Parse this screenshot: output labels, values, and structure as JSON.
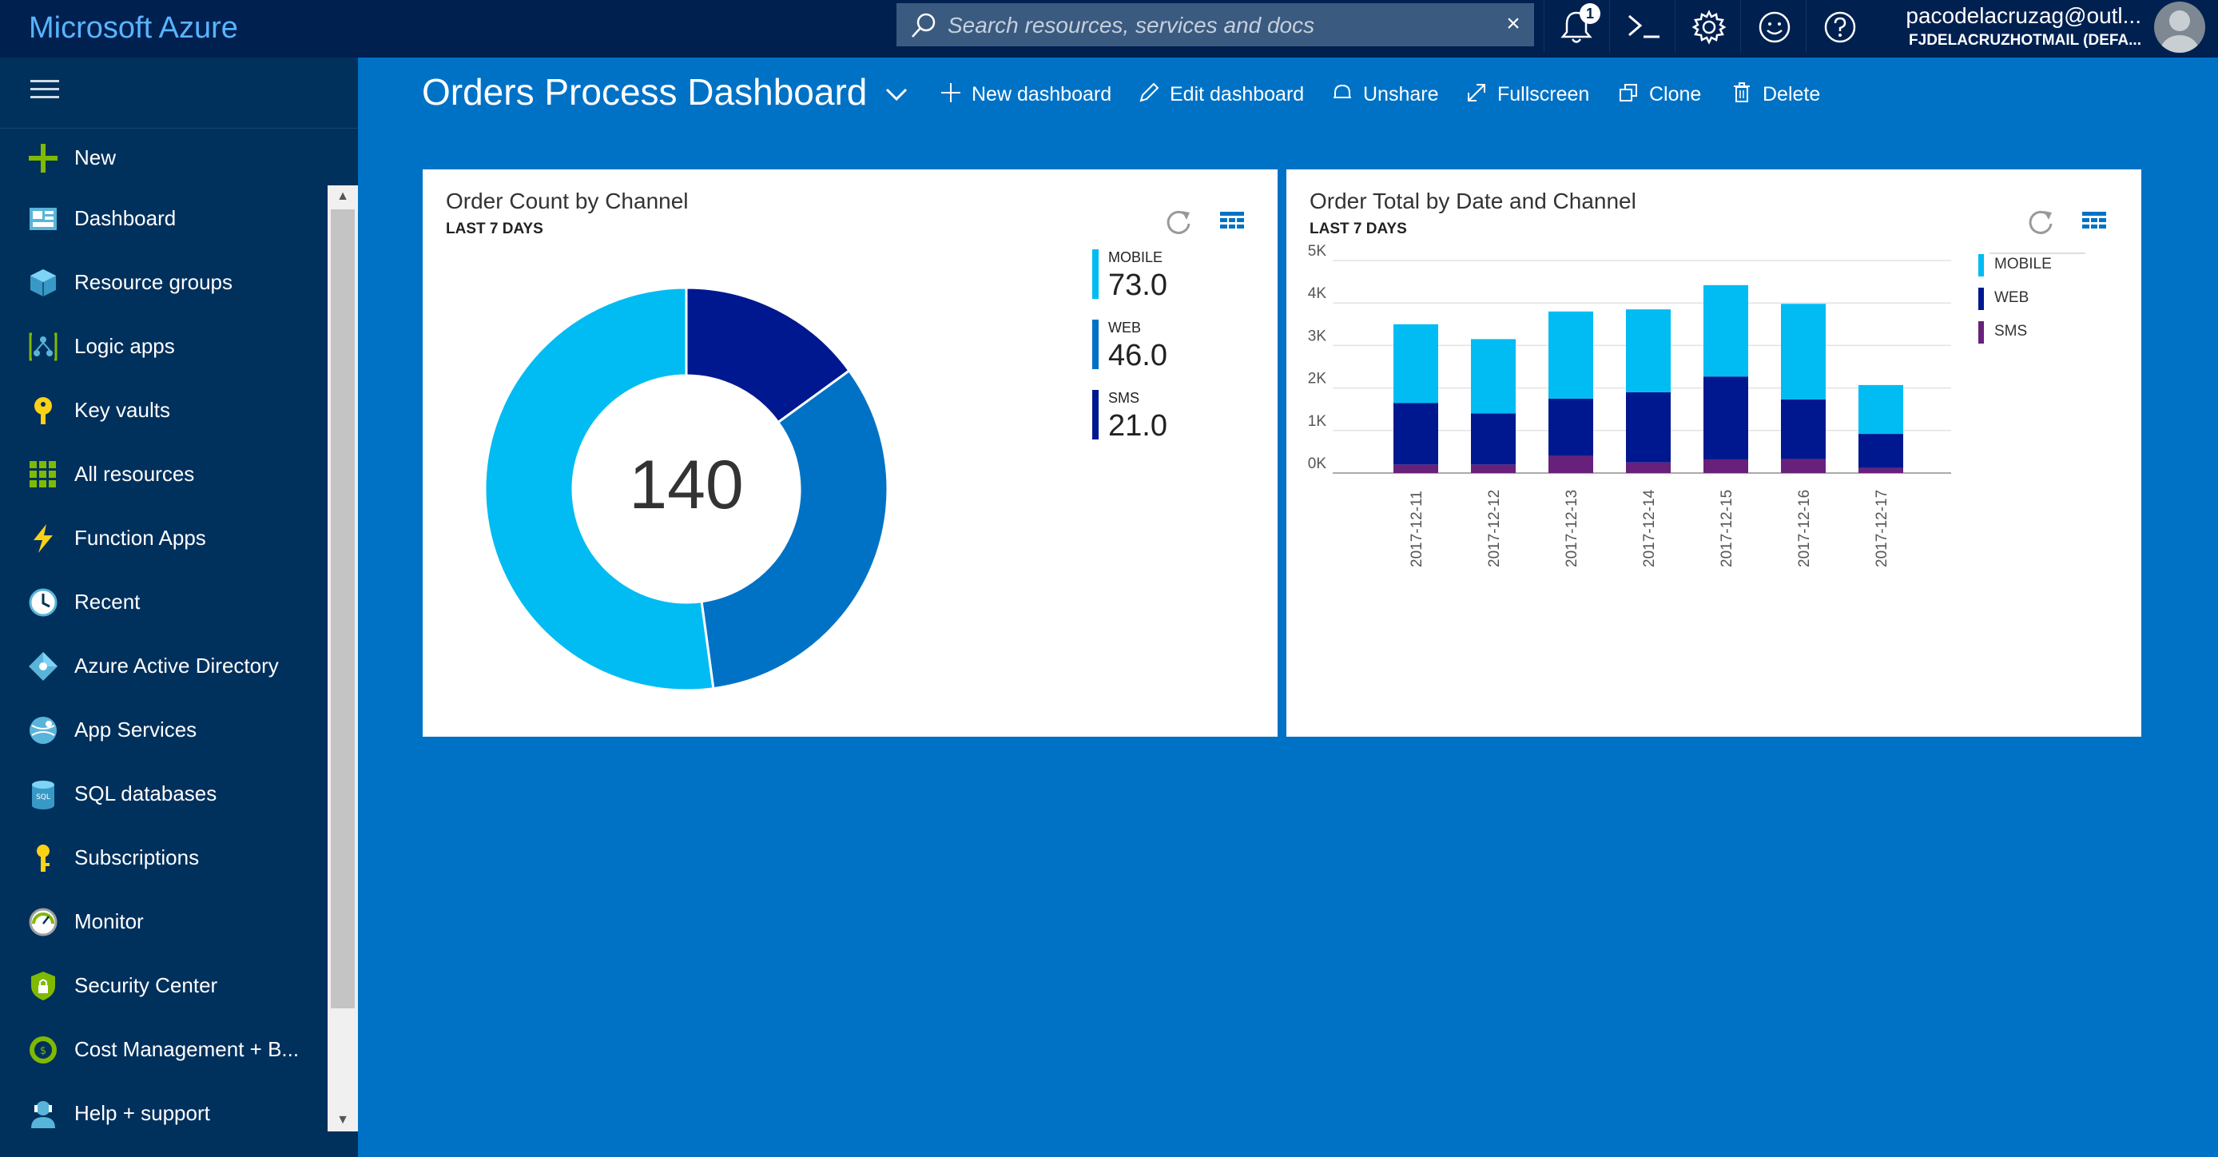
{
  "app": {
    "title": "Microsoft Azure"
  },
  "search": {
    "placeholder": "Search resources, services and docs",
    "clear": "×"
  },
  "topbar": {
    "notifications_count": "1"
  },
  "account": {
    "email": "pacodelacruzag@outl...",
    "tenant": "FJDELACRUZHOTMAIL (DEFA..."
  },
  "sidebar": {
    "items": [
      {
        "label": "New",
        "icon": "plus-icon"
      },
      {
        "label": "Dashboard",
        "icon": "dashboard-icon"
      },
      {
        "label": "Resource groups",
        "icon": "resource-groups-icon"
      },
      {
        "label": "Logic apps",
        "icon": "logic-apps-icon"
      },
      {
        "label": "Key vaults",
        "icon": "key-vault-icon"
      },
      {
        "label": "All resources",
        "icon": "all-resources-icon"
      },
      {
        "label": "Function Apps",
        "icon": "function-apps-icon"
      },
      {
        "label": "Recent",
        "icon": "clock-icon"
      },
      {
        "label": "Azure Active Directory",
        "icon": "active-directory-icon"
      },
      {
        "label": "App Services",
        "icon": "app-services-icon"
      },
      {
        "label": "SQL databases",
        "icon": "sql-database-icon"
      },
      {
        "label": "Subscriptions",
        "icon": "key-icon"
      },
      {
        "label": "Monitor",
        "icon": "monitor-icon"
      },
      {
        "label": "Security Center",
        "icon": "shield-icon"
      },
      {
        "label": "Cost Management + B...",
        "icon": "cost-management-icon"
      },
      {
        "label": "Help + support",
        "icon": "help-support-icon"
      }
    ]
  },
  "dashboard": {
    "title": "Orders Process Dashboard",
    "commands": {
      "new": "New dashboard",
      "edit": "Edit dashboard",
      "unshare": "Unshare",
      "fullscreen": "Fullscreen",
      "clone": "Clone",
      "delete": "Delete"
    }
  },
  "tiles": {
    "donut": {
      "title": "Order Count by Channel",
      "subtitle": "LAST 7 DAYS",
      "total": "140",
      "legend": [
        {
          "name": "MOBILE",
          "value": "73.0"
        },
        {
          "name": "WEB",
          "value": "46.0"
        },
        {
          "name": "SMS",
          "value": "21.0"
        }
      ]
    },
    "bars": {
      "title": "Order Total by Date and Channel",
      "subtitle": "LAST 7 DAYS",
      "legend": [
        "MOBILE",
        "WEB",
        "SMS"
      ]
    }
  },
  "colors": {
    "mobile": "#00bcf2",
    "web_donut": "#0072c6",
    "web": "#00188f",
    "sms": "#00188f",
    "sms_bar": "#68217a"
  },
  "chart_data": [
    {
      "type": "pie",
      "title": "Order Count by Channel",
      "categories": [
        "MOBILE",
        "WEB",
        "SMS"
      ],
      "values": [
        73,
        46,
        21
      ],
      "total": 140
    },
    {
      "type": "bar",
      "title": "Order Total by Date and Channel",
      "stacked": true,
      "categories": [
        "2017-12-11",
        "2017-12-12",
        "2017-12-13",
        "2017-12-14",
        "2017-12-15",
        "2017-12-16",
        "2017-12-17"
      ],
      "series": [
        {
          "name": "SMS",
          "values": [
            200,
            200,
            400,
            250,
            320,
            330,
            120
          ]
        },
        {
          "name": "WEB",
          "values": [
            1450,
            1200,
            1350,
            1650,
            1950,
            1400,
            800
          ]
        },
        {
          "name": "MOBILE",
          "values": [
            1850,
            1750,
            2050,
            1950,
            2150,
            2250,
            1150
          ]
        }
      ],
      "ylim": [
        0,
        5000
      ],
      "yticks": [
        "0K",
        "1K",
        "2K",
        "3K",
        "4K",
        "5K"
      ],
      "grid": true,
      "legend_position": "right"
    }
  ]
}
